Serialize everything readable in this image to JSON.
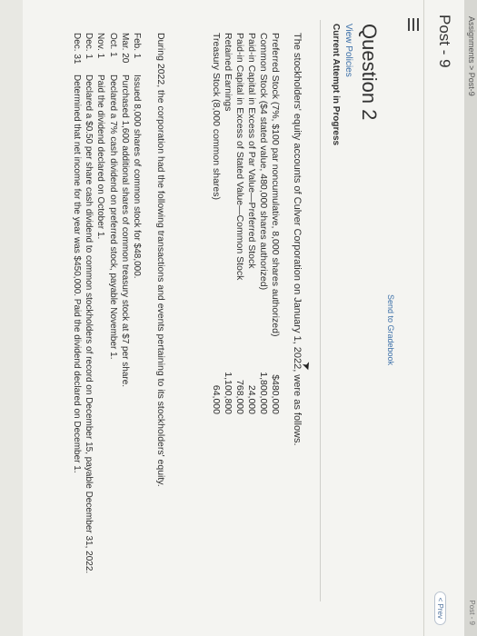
{
  "top_strip": {
    "crumb": "Assignments > Post-9",
    "right_text": "Post - 9"
  },
  "header": {
    "title": "Post - 9",
    "prev_label": "< Prev"
  },
  "question": {
    "title": "Question 2",
    "view_policies": "View Policies",
    "attempt_status": "Current Attempt in Progress",
    "send_to_gradebook": "Send to Gradebook",
    "intro": "The stockholders' equity accounts of Culver Corporation on January 1, 2022, were as follows.",
    "accounts": [
      {
        "name": "Preferred Stock (7%, $100 par noncumulative, 8,000 shares authorized)",
        "amount": "$480,000"
      },
      {
        "name": "Common Stock ($4 stated value, 480,000 shares authorized)",
        "amount": "1,800,000"
      },
      {
        "name": "Paid-in Capital in Excess of Par Value—Preferred Stock",
        "amount": "24,000"
      },
      {
        "name": "Paid-in Capital in Excess of Stated Value—Common Stock",
        "amount": "768,000"
      },
      {
        "name": "Retained Earnings",
        "amount": "1,100,800"
      },
      {
        "name": "Treasury Stock (8,000 common shares)",
        "amount": "64,000"
      }
    ],
    "during_text": "During 2022, the corporation had the following transactions and events pertaining to its stockholders' equity.",
    "transactions": [
      {
        "date": "Feb.  1",
        "text": "Issued 8,000 shares of common stock for $48,000."
      },
      {
        "date": "Mar. 20",
        "text": "Purchased 1,600 additional shares of common treasury stock at $7 per share."
      },
      {
        "date": "Oct.  1",
        "text": "Declared a 7% cash dividend on preferred stock, payable November 1."
      },
      {
        "date": "Nov.  1",
        "text": "Paid the dividend declared on October 1."
      },
      {
        "date": "Dec.  1",
        "text": "Declared a $0.50 per share cash dividend to common stockholders of record on December 15, payable December 31, 2022."
      },
      {
        "date": "Dec. 31",
        "text": "Determined that net income for the year was $450,000. Paid the dividend declared on December 1."
      }
    ]
  }
}
